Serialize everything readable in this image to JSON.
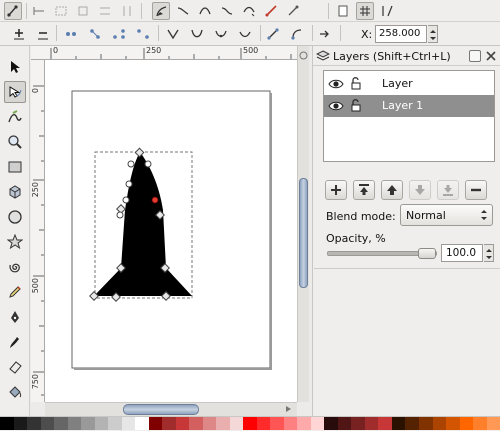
{
  "icons": {
    "toolbar_row1": [
      "select-toggle-icon",
      "snap-icon",
      "snap-bbox-icon",
      "snap-nodes-icon",
      "snap-guide-icon",
      "snap-grid-icon",
      "node-edit-icon",
      "cusp-icon",
      "smooth-icon",
      "symmetric-icon",
      "auto-smooth-icon",
      "document-icon",
      "grid-toggle-icon",
      "guide-toggle-icon"
    ],
    "toolbar_row2": [
      "insert-node-icon",
      "delete-node-icon",
      "join-nodes-icon",
      "break-path-icon",
      "join-segment-icon",
      "delete-segment-icon",
      "make-cusp-icon",
      "make-smooth-icon",
      "make-symmetric-icon",
      "make-auto-icon",
      "line-segment-icon",
      "curve-segment-icon",
      "object-to-path-icon",
      "stroke-to-path-icon"
    ],
    "tools": [
      "selector-tool-icon",
      "node-tool-icon",
      "tweak-tool-icon",
      "zoom-tool-icon",
      "rect-tool-icon",
      "box-3d-tool-icon",
      "ellipse-tool-icon",
      "star-tool-icon",
      "spiral-tool-icon",
      "pencil-tool-icon",
      "pen-tool-icon",
      "calligraphy-tool-icon",
      "eraser-tool-icon",
      "bucket-tool-icon"
    ]
  },
  "node_toolbar": {
    "x_label": "X:",
    "x_value": "258.000"
  },
  "ruler": {
    "h_ticks": [
      "0",
      "250",
      "500"
    ],
    "v_ticks": [
      "0",
      "250",
      "500",
      "750"
    ]
  },
  "layers_panel": {
    "title": "Layers (Shift+Ctrl+L)",
    "layers": [
      {
        "name": "Layer",
        "visible": true,
        "locked": false,
        "selected": false
      },
      {
        "name": "Layer 1",
        "visible": true,
        "locked": false,
        "selected": true
      }
    ],
    "blend_label": "Blend mode:",
    "blend_value": "Normal",
    "opacity_label": "Opacity, %",
    "opacity_value": "100.0",
    "opacity_level": 1.0
  },
  "colors": {
    "selected_layer": "#8f8f8f",
    "shape_fill": "#000000",
    "node_selected": "#e33b2e",
    "palette": [
      "#000000",
      "#1a1a1a",
      "#333333",
      "#4d4d4d",
      "#666666",
      "#808080",
      "#999999",
      "#b3b3b3",
      "#cccccc",
      "#e6e6e6",
      "#ffffff",
      "#800000",
      "#a02c2c",
      "#c83737",
      "#d35f5f",
      "#de8787",
      "#e9afaf",
      "#f4d7d7",
      "#ff0000",
      "#ff2a2a",
      "#ff5555",
      "#ff8080",
      "#ffaaaa",
      "#ffd5d5",
      "#280b0b",
      "#501616",
      "#782121",
      "#a02c2c",
      "#c83737",
      "#2b1100",
      "#552200",
      "#803300",
      "#aa4400",
      "#d45500",
      "#ff6600",
      "#ff7f2a",
      "#ff9955"
    ]
  }
}
